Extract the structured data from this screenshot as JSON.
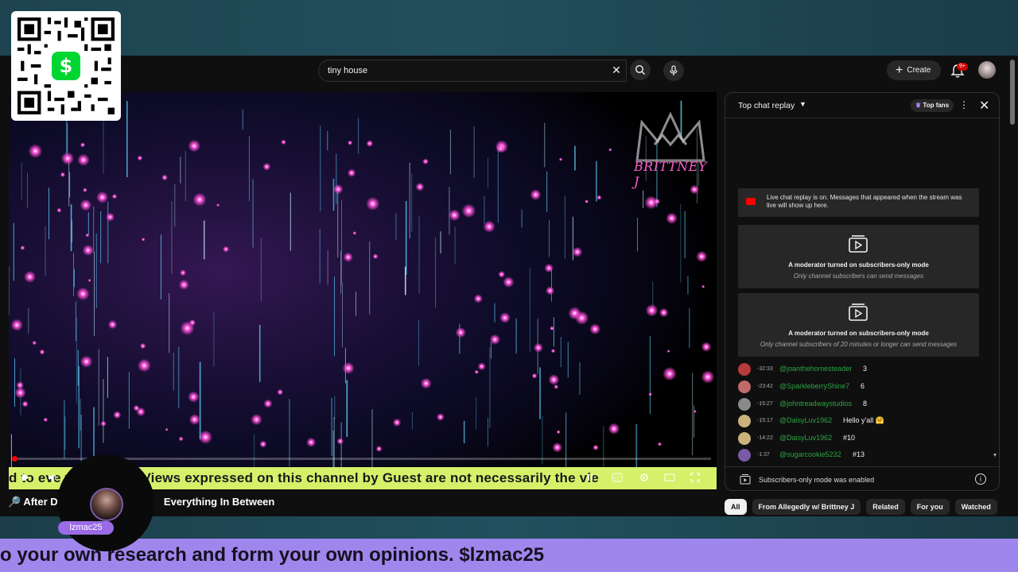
{
  "overlay": {
    "cashtag_icon": "dollar-icon",
    "streamer_name": "lzmac25",
    "bottom_ticker": "o your own research and form your own opinions. $lzmac25",
    "brand": "BRITTNEY J"
  },
  "header": {
    "search_value": "tiny house",
    "create_label": "Create",
    "notification_badge": "9+"
  },
  "player": {
    "ticker_text": "d to eve          where! The Views expressed on this channel by Guest are not necessarily the vie",
    "title_left": "After D",
    "title_right": "Everything In Between",
    "progress": 0.0
  },
  "chat": {
    "title": "Top chat replay",
    "top_fans_label": "Top fans",
    "replay_banner": "Live chat replay is on. Messages that appeared when the stream was live will show up here.",
    "mod_cards": [
      {
        "title": "A moderator turned on subscribers-only mode",
        "subtitle": "Only channel subscribers can send messages"
      },
      {
        "title": "A moderator turned on subscribers-only mode",
        "subtitle": "Only channel subscribers of 20 minutes or longer can send messages"
      }
    ],
    "messages": [
      {
        "time": "-32:33",
        "name": "@joanthehomesteader",
        "text": "3",
        "avatar_color": "#b83a3a"
      },
      {
        "time": "-23:42",
        "name": "@SparkleberryShine7",
        "text": "6",
        "avatar_color": "#c26a6a"
      },
      {
        "time": "-15:27",
        "name": "@johntreadwaystudios",
        "text": "8",
        "avatar_color": "#8a8a8a"
      },
      {
        "time": "-15:17",
        "name": "@DaisyLuv1962",
        "text": "Hello y'all 🤗",
        "avatar_color": "#c9b37a"
      },
      {
        "time": "-14:22",
        "name": "@DaisyLuv1962",
        "text": "#10",
        "avatar_color": "#c9b37a"
      },
      {
        "time": "-1:37",
        "name": "@sugarcookie5232",
        "text": "#13",
        "avatar_color": "#7a5aa6"
      }
    ],
    "footer_text": "Subscribers-only mode was enabled"
  },
  "chips": [
    "All",
    "From Allegedly w/ Brittney J",
    "Related",
    "For you",
    "Watched"
  ],
  "colors": {
    "accent_green": "#d6f06a",
    "accent_purple": "#9f86ec",
    "youtube_red": "#ff0000",
    "chat_name_green": "#2ba640"
  }
}
